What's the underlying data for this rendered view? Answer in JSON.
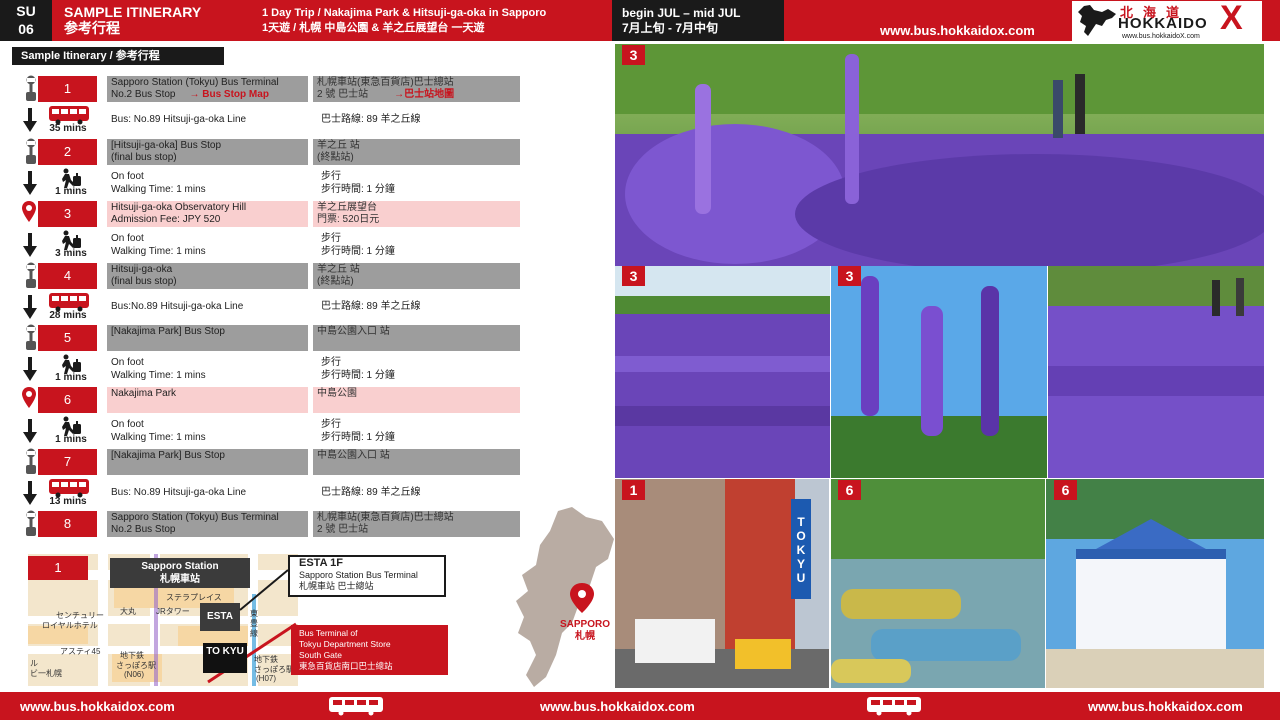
{
  "header": {
    "su_label": "SU",
    "su_number": "06",
    "title_en": "SAMPLE ITINERARY",
    "title_zh": "参考行程",
    "trip_en": "1 Day Trip / Nakajima Park & Hitsuji-ga-oka in Sapporo",
    "trip_zh": "1天遊 / 札幌 中島公園 & 羊之丘展望台 一天遊",
    "season_en": "begin JUL –  mid JUL",
    "season_zh": "7月上旬 - 7月中旬",
    "url": "www.bus.hokkaidox.com"
  },
  "logo": {
    "kanji": "北海道",
    "name": "HOKKAIDO",
    "x": "X",
    "url": "www.bus.hokkaidoX.com"
  },
  "section_label": "Sample Itinerary / 参考行程",
  "stops": [
    {
      "num": "1",
      "en1": "Sapporo Station (Tokyu) Bus Terminal",
      "en2": "No.2 Bus Stop",
      "link": "→ Bus Stop Map",
      "zh1": "札幌車站(東急百貨店)巴士總站",
      "zh2": "2 號 巴士站",
      "zh_link": "→巴士站地圖"
    },
    {
      "num": "2",
      "en1": "[Hitsuji-ga-oka] Bus Stop",
      "en2": "(final bus stop)",
      "zh1": "羊之丘 站",
      "zh2": "(終點站)"
    },
    {
      "num": "3",
      "en1": "Hitsuji-ga-oka Observatory Hill",
      "en2": "Admission Fee: JPY 520",
      "zh1": "羊之丘展望台",
      "zh2": "門票: 520日元"
    },
    {
      "num": "4",
      "en1": "Hitsuji-ga-oka",
      "en2": "(final bus stop)",
      "zh1": "羊之丘 站",
      "zh2": "(終點站)"
    },
    {
      "num": "5",
      "en1": "[Nakajima Park] Bus Stop",
      "en2": "",
      "zh1": "中島公園入口 站",
      "zh2": ""
    },
    {
      "num": "6",
      "en1": "Nakajima Park",
      "en2": "",
      "zh1": "中島公園",
      "zh2": ""
    },
    {
      "num": "7",
      "en1": "[Nakajima Park] Bus Stop",
      "en2": "",
      "zh1": "中島公園入口 站",
      "zh2": ""
    },
    {
      "num": "8",
      "en1": "Sapporo Station (Tokyu) Bus Terminal",
      "en2": "No.2 Bus Stop",
      "zh1": "札幌車站(東急百貨店)巴士總站",
      "zh2": "2 號 巴士站"
    }
  ],
  "transits": [
    {
      "mode": "bus",
      "time": "35 mins",
      "en1": "Bus: No.89 Hitsuji-ga-oka Line",
      "en2": "",
      "zh1": "巴士路線: 89  羊之丘線",
      "zh2": ""
    },
    {
      "mode": "walk",
      "time": "1 mins",
      "en1": "On foot",
      "en2": "Walking Time:  1 mins",
      "zh1": "步行",
      "zh2": "步行時間: 1 分鐘"
    },
    {
      "mode": "walk",
      "time": "3 mins",
      "en1": "On foot",
      "en2": "Walking Time:  1 mins",
      "zh1": "步行",
      "zh2": "步行時間: 1 分鐘"
    },
    {
      "mode": "bus",
      "time": "28 mins",
      "en1": "Bus:No.89 Hitsuji-ga-oka Line",
      "en2": "",
      "zh1": "巴士路線: 89  羊之丘線",
      "zh2": ""
    },
    {
      "mode": "walk",
      "time": "1 mins",
      "en1": "On foot",
      "en2": "Walking Time:  1 mins",
      "zh1": "步行",
      "zh2": "步行時間: 1 分鐘"
    },
    {
      "mode": "walk",
      "time": "1 mins",
      "en1": "On foot",
      "en2": "Walking Time:  1 mins",
      "zh1": "步行",
      "zh2": "步行時間: 1 分鐘"
    },
    {
      "mode": "bus",
      "time": "13 mins",
      "en1": "Bus: No.89 Hitsuji-ga-oka Line",
      "en2": "",
      "zh1": "巴士路線: 89  羊之丘線",
      "zh2": ""
    }
  ],
  "minimap": {
    "num": "1",
    "station_en": "Sapporo Station",
    "station_zh": "札幌車站",
    "esta": "ESTA",
    "tokyu": "TO KYU",
    "labels": [
      "ステラプレイス",
      "大丸",
      "JRタワー",
      "センチュリー",
      "ロイヤルホテル",
      "アスティ45",
      "地下鉄",
      "さっぽろ駅",
      "(N06)",
      "ル",
      "ビ一札幌",
      "地下鉄",
      "さっぽろ駅",
      "(H07)",
      "東",
      "豊",
      "線"
    ],
    "callout1_title": "ESTA 1F",
    "callout1_l1": "Sapporo Station  Bus Terminal",
    "callout1_l2": "札幌車站 巴士總站",
    "callout2_l1": "Bus Terminal of",
    "callout2_l2": "Tokyu Department Store",
    "callout2_l3": "South Gate",
    "callout2_l4": "東急百貨店南口巴士總站"
  },
  "hokkaido_map": {
    "city_en": "SAPPORO",
    "city_zh": "札幌"
  },
  "photos": [
    {
      "num": "3",
      "subject": "lavender field with visitors"
    },
    {
      "num": "3",
      "subject": "lavender field"
    },
    {
      "num": "3",
      "subject": "lavender close-up"
    },
    {
      "num": "",
      "subject": "lavender field with walkers"
    },
    {
      "num": "1",
      "subject": "Sapporo Station Tokyu building",
      "sign": "TOKYU"
    },
    {
      "num": "6",
      "subject": "boats on pond at Nakajima Park"
    },
    {
      "num": "6",
      "subject": "Hoheikan western building"
    }
  ],
  "footer": {
    "url_left": "www.bus.hokkaidox.com",
    "url_center": "www.bus.hokkaidox.com",
    "url_right": "www.bus.hokkaidox.com"
  },
  "colors": {
    "brand_red": "#c8141e",
    "dark": "#1a1a1a",
    "gray_row": "#9d9d9d",
    "pink_row": "#f9cfcf",
    "lavender": "#7a4fc4"
  },
  "icons": [
    "bus-stop-icon",
    "map-pin-icon",
    "down-arrow-icon",
    "bus-icon",
    "walking-icon"
  ]
}
